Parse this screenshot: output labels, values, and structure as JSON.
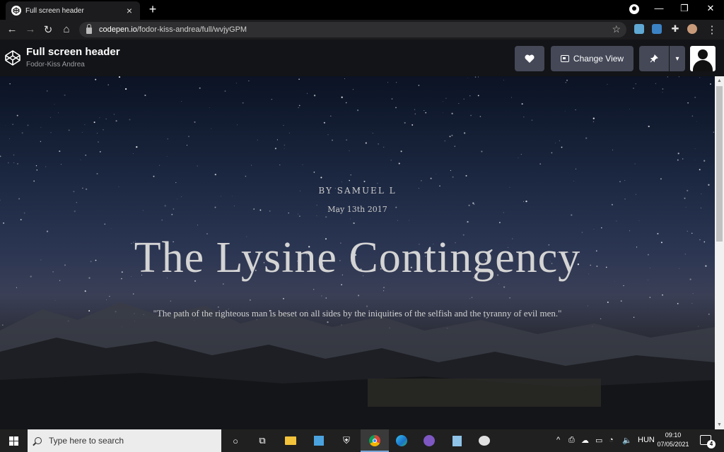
{
  "browser": {
    "tab_title": "Full screen header",
    "url_domain": "codepen.io",
    "url_path": "/fodor-kiss-andrea/full/wvjyGPM"
  },
  "codepen": {
    "pen_title": "Full screen header",
    "author": "Fodor-Kiss Andrea",
    "change_view_label": "Change View"
  },
  "hero": {
    "byline": "BY SAMUEL L",
    "date": "May 13th 2017",
    "headline": "The Lysine Contingency",
    "quote": "\"The path of the righteous man is beset on all sides by the iniquities of the selfish and the tyranny of evil men.\""
  },
  "taskbar": {
    "search_placeholder": "Type here to search",
    "language": "HUN",
    "time": "09:10",
    "date": "07/05/2021",
    "notification_count": "4"
  },
  "colors": {
    "codepen_header_bg": "#131417",
    "button_bg": "#444857",
    "taskbar_bg": "#202020"
  }
}
